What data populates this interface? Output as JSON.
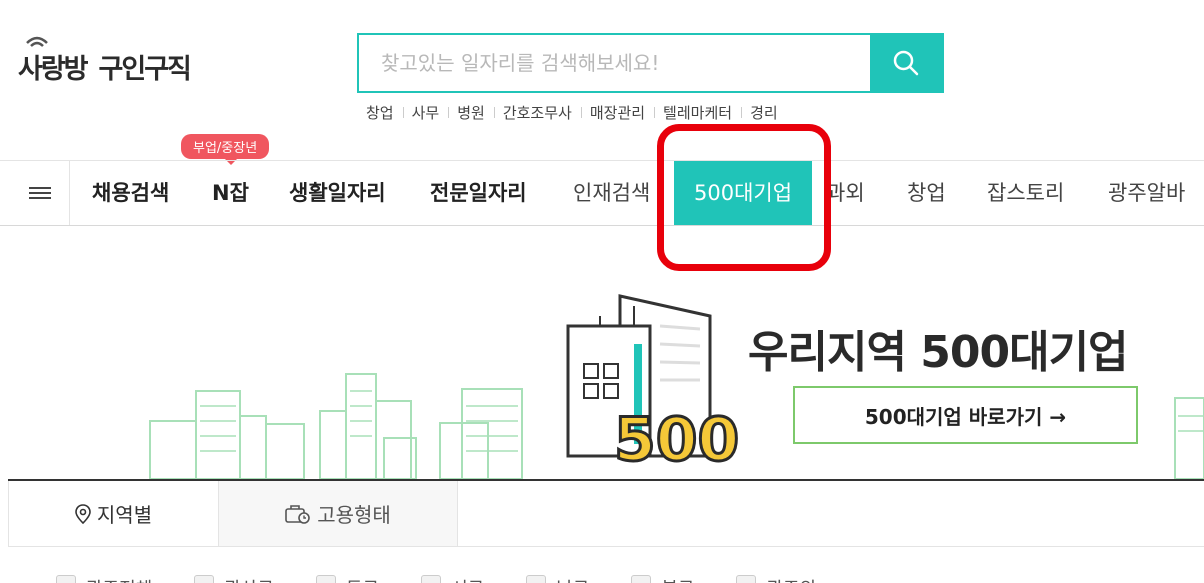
{
  "header": {
    "logo_text_1": "사랑방",
    "logo_text_2": "구인구직",
    "search_placeholder": "찾고있는 일자리를 검색해보세요!",
    "search_value": "",
    "keywords": [
      "창업",
      "사무",
      "병원",
      "간호조무사",
      "매장관리",
      "텔레마케터",
      "경리"
    ]
  },
  "nav": {
    "badge": "부업/중장년",
    "items": [
      {
        "label": "채용검색"
      },
      {
        "label": "N잡"
      },
      {
        "label": "생활일자리"
      },
      {
        "label": "전문일자리"
      },
      {
        "label": "인재검색"
      },
      {
        "label": "500대기업"
      },
      {
        "label": "과외"
      },
      {
        "label": "창업"
      },
      {
        "label": "잡스토리"
      },
      {
        "label": "광주알바"
      }
    ],
    "active_index": 5
  },
  "banner": {
    "title": "우리지역 500대기업",
    "button_label": "500대기업 바로가기 →",
    "art_text": "500"
  },
  "tabs": [
    {
      "label": "지역별",
      "icon": "location-pin-icon"
    },
    {
      "label": "고용형태",
      "icon": "briefcase-clock-icon"
    }
  ],
  "regions": [
    "광주전체",
    "광산구",
    "동구",
    "서구",
    "남구",
    "북구",
    "광주외"
  ],
  "colors": {
    "accent": "#20c4b8",
    "badge": "#f0565f",
    "highlight": "#e8000b",
    "button_border": "#7dc96b",
    "art_green": "#a8e0b8"
  }
}
